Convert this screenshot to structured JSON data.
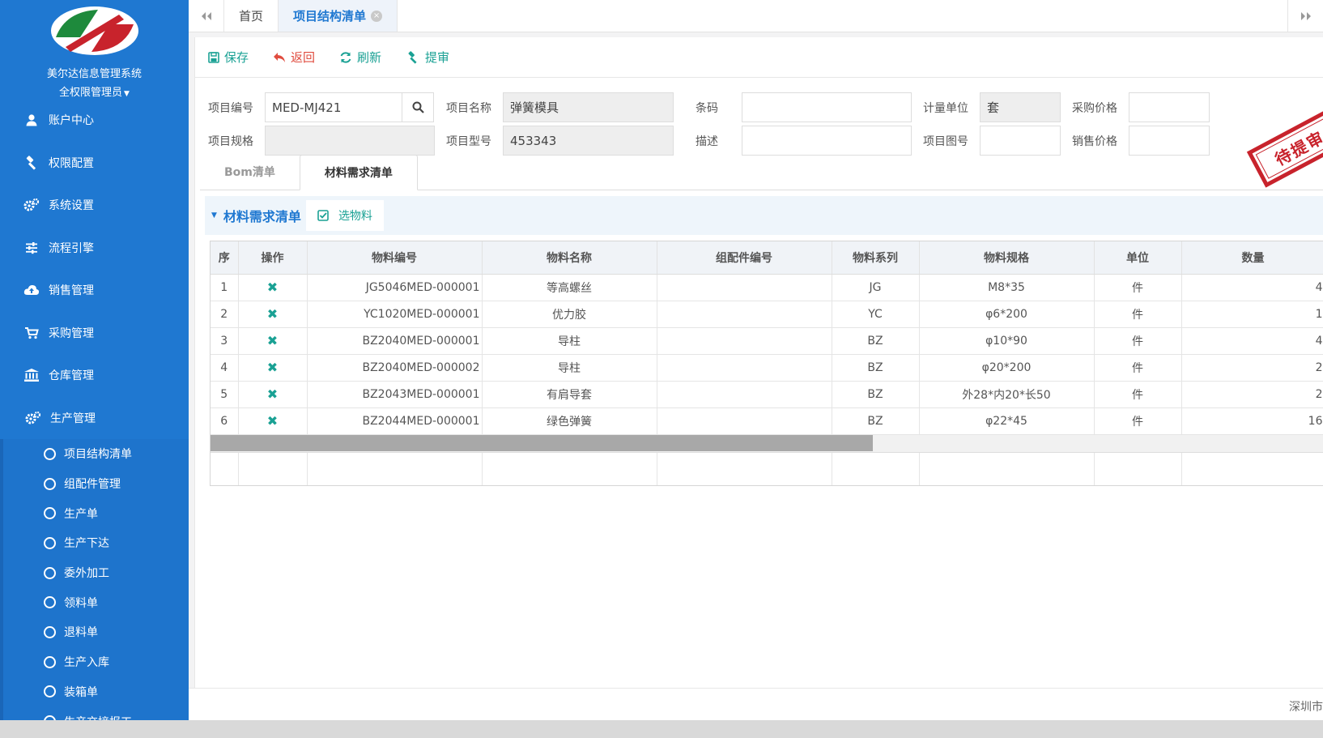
{
  "sidebar": {
    "system_name": "美尔达信息管理系统",
    "user_role": "全权限管理员",
    "menu": [
      {
        "label": "账户中心",
        "icon": "user-icon"
      },
      {
        "label": "权限配置",
        "icon": "gavel-icon"
      },
      {
        "label": "系统设置",
        "icon": "gears-icon"
      },
      {
        "label": "流程引擎",
        "icon": "sliders-icon"
      },
      {
        "label": "销售管理",
        "icon": "cloud-upload-icon"
      },
      {
        "label": "采购管理",
        "icon": "cart-icon"
      },
      {
        "label": "仓库管理",
        "icon": "bank-icon"
      },
      {
        "label": "生产管理",
        "icon": "gears-icon"
      }
    ],
    "submenu": [
      "项目结构清单",
      "组配件管理",
      "生产单",
      "生产下达",
      "委外加工",
      "领料单",
      "退料单",
      "生产入库",
      "装箱单",
      "生产交接报工"
    ]
  },
  "tabs": {
    "home": "首页",
    "active": "项目结构清单",
    "close_glyph": "×"
  },
  "toolbar": {
    "save": "保存",
    "back": "返回",
    "refresh": "刷新",
    "submit": "提审"
  },
  "form": {
    "project_code_label": "项目编号",
    "project_code_value": "MED-MJ421",
    "project_name_label": "项目名称",
    "project_name_value": "弹簧模具",
    "barcode_label": "条码",
    "barcode_value": "",
    "unit_label": "计量单位",
    "unit_value": "套",
    "purchase_price_label": "采购价格",
    "purchase_price_value": "",
    "spec_label": "项目规格",
    "spec_value": "",
    "model_label": "项目型号",
    "model_value": "453343",
    "desc_label": "描述",
    "desc_value": "",
    "drawing_label": "项目图号",
    "drawing_value": "",
    "sale_price_label": "销售价格",
    "sale_price_value": ""
  },
  "stamp": "待提审",
  "subtabs": [
    "Bom清单",
    "材料需求清单"
  ],
  "section": {
    "title": "材料需求清单",
    "select_button": "选物料"
  },
  "table": {
    "headers": [
      "序",
      "操作",
      "物料编号",
      "物料名称",
      "组配件编号",
      "物料系列",
      "物料规格",
      "单位",
      "数量"
    ],
    "rows": [
      {
        "no": "1",
        "code": "JG5046MED-000001",
        "name": "等高螺丝",
        "assembly": "",
        "series": "JG",
        "spec": "M8*35",
        "unit": "件",
        "qty": "4"
      },
      {
        "no": "2",
        "code": "YC1020MED-000001",
        "name": "优力胶",
        "assembly": "",
        "series": "YC",
        "spec": "φ6*200",
        "unit": "件",
        "qty": "1"
      },
      {
        "no": "3",
        "code": "BZ2040MED-000001",
        "name": "导柱",
        "assembly": "",
        "series": "BZ",
        "spec": "φ10*90",
        "unit": "件",
        "qty": "4"
      },
      {
        "no": "4",
        "code": "BZ2040MED-000002",
        "name": "导柱",
        "assembly": "",
        "series": "BZ",
        "spec": "φ20*200",
        "unit": "件",
        "qty": "2"
      },
      {
        "no": "5",
        "code": "BZ2043MED-000001",
        "name": "有肩导套",
        "assembly": "",
        "series": "BZ",
        "spec": "外28*内20*长50",
        "unit": "件",
        "qty": "2"
      },
      {
        "no": "6",
        "code": "BZ2044MED-000001",
        "name": "绿色弹簧",
        "assembly": "",
        "series": "BZ",
        "spec": "φ22*45",
        "unit": "件",
        "qty": "16"
      }
    ],
    "delete_glyph": "✖"
  },
  "footer": {
    "text": "深圳市"
  },
  "colors": {
    "sidebar": "#1f78d1",
    "accent_green": "#1aa194",
    "back_red": "#e04c3f",
    "stamp_red": "#c8232c"
  }
}
